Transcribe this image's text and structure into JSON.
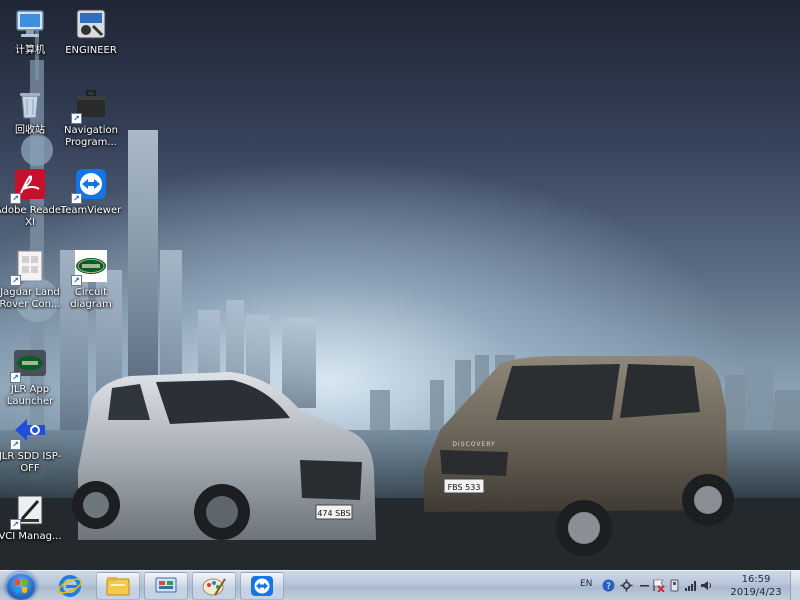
{
  "desktop": {
    "icons": [
      {
        "label": "计算机",
        "icon": "computer-icon",
        "shortcut": false
      },
      {
        "label": "ENGINEER",
        "icon": "engineer-tool-icon",
        "shortcut": false
      },
      {
        "label": "回收站",
        "icon": "recycle-bin-icon",
        "shortcut": false
      },
      {
        "label": "Navigation Program...",
        "icon": "briefcase-icon",
        "shortcut": true
      },
      {
        "label": "Adobe Reader XI",
        "icon": "adobe-reader-icon",
        "shortcut": true
      },
      {
        "label": "TeamViewer",
        "icon": "teamviewer-icon",
        "shortcut": true
      },
      {
        "label": "Jaguar Land Rover Con...",
        "icon": "document-icon",
        "shortcut": true
      },
      {
        "label": "Circuit diagram",
        "icon": "land-rover-logo-icon",
        "shortcut": true
      },
      {
        "label": "JLR App Launcher",
        "icon": "land-rover-app-icon",
        "shortcut": true
      },
      {
        "label": "JLR SDD ISP-OFF",
        "icon": "sdd-arrow-icon",
        "shortcut": true
      },
      {
        "label": "VCI Manag...",
        "icon": "vci-manager-icon",
        "shortcut": true
      }
    ],
    "wallpaper": {
      "plate_left": "474 SBS",
      "plate_right": "FBS 533",
      "badge_right": "DISCOVERY"
    }
  },
  "taskbar": {
    "pinned": [
      {
        "icon": "internet-explorer-icon"
      },
      {
        "icon": "file-explorer-icon"
      },
      {
        "icon": "control-panel-icon"
      },
      {
        "icon": "paint-icon"
      },
      {
        "icon": "teamviewer-icon"
      }
    ],
    "tray": {
      "language": "EN",
      "time": "16:59",
      "date": "2019/4/23"
    }
  },
  "colors": {
    "accent": "#2c6fc9",
    "taskbar": "#b8c6d8",
    "label_text": "#ffffff"
  }
}
